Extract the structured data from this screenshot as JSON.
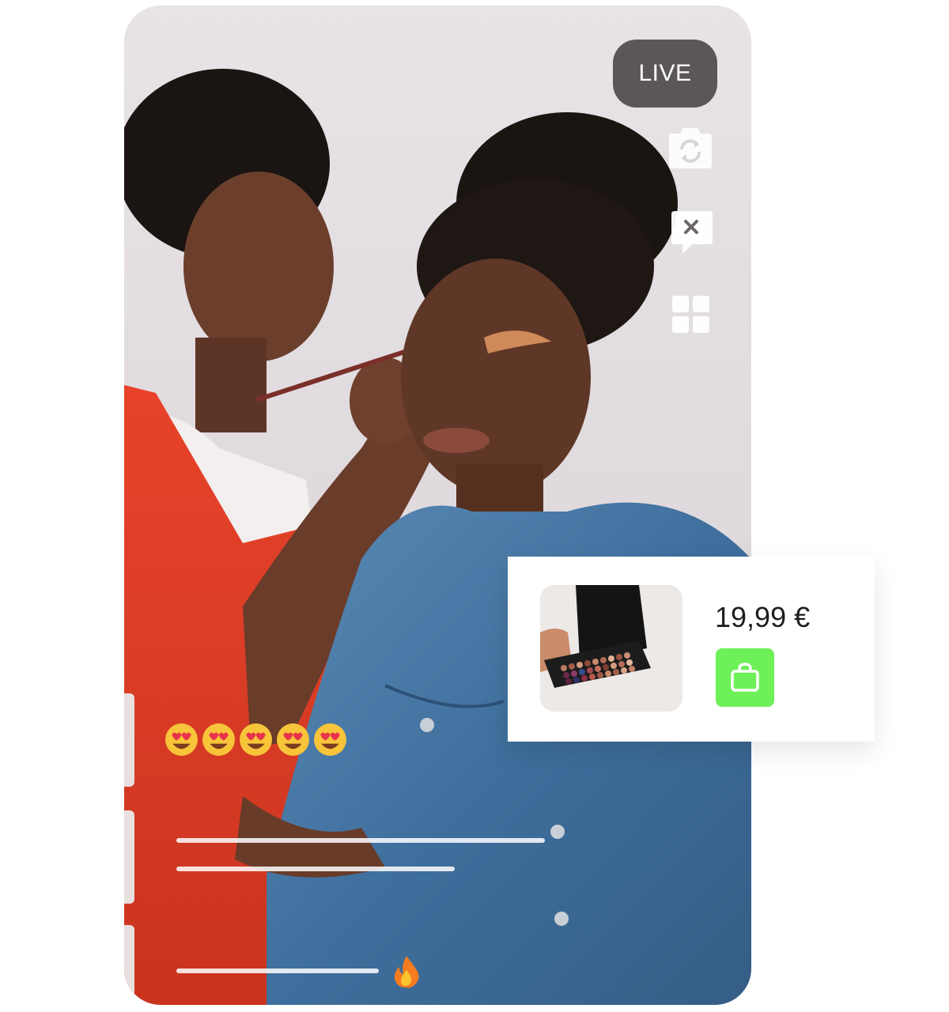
{
  "stream": {
    "live_label": "LIVE",
    "reactions": [
      "heart-eyes-emoji",
      "heart-eyes-emoji",
      "heart-eyes-emoji",
      "heart-eyes-emoji",
      "heart-eyes-emoji"
    ],
    "side_icons": [
      "camera-flip-icon",
      "chat-off-icon",
      "grid-icon"
    ]
  },
  "product": {
    "image": "eyeshadow-palette",
    "price": "19,99 €",
    "buy_icon": "shopping-bag-icon",
    "buy_color": "#6ef058"
  },
  "colors": {
    "live_badge": "#5b5657",
    "background": "#ffffff"
  }
}
